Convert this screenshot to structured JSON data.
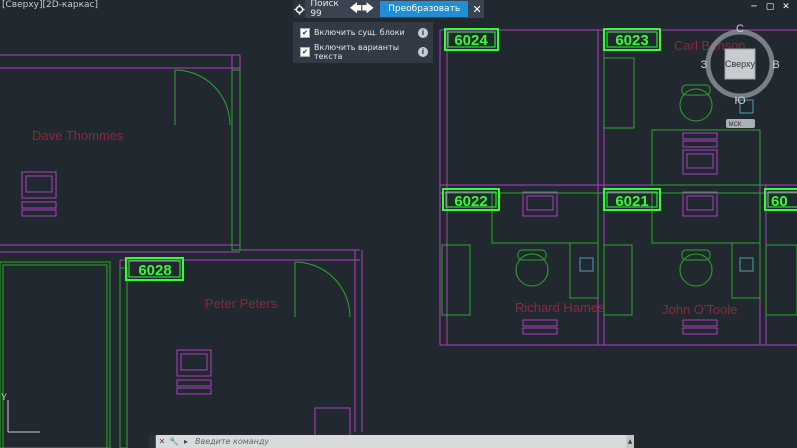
{
  "viewport": {
    "label": "[Сверху][2D-каркас]"
  },
  "find_toolbar": {
    "search_label": "Поиск 99",
    "prev_arrow": "🡄",
    "next_arrow": "🡆",
    "convert_label": "Преобразовать",
    "close_glyph": "✕"
  },
  "find_options": [
    {
      "label": "Включить сущ. блоки",
      "checked": true
    },
    {
      "label": "Включить варианты текста",
      "checked": true
    }
  ],
  "room_tags": [
    "6024",
    "6023",
    "6022",
    "6021",
    "60",
    "6028"
  ],
  "occupants": [
    "Dave Thommes",
    "Peter Peters",
    "Richard Hames",
    "John O'Toole",
    "Carl Benson"
  ],
  "viewcube": {
    "north": "С",
    "south": "Ю",
    "west": "З",
    "east": "В",
    "face": "Сверху",
    "ucs": "МСК"
  },
  "axis": {
    "y": "Y"
  },
  "command_line": {
    "placeholder": "Введите команду",
    "close": "✕",
    "wrench": "🔧",
    "chevron": "▸"
  },
  "window_buttons": {
    "min": "─",
    "restore": "▢",
    "close": "✕"
  },
  "colors": {
    "background": "#212830",
    "walls": "#b03fc0",
    "furniture": "#2ca82c",
    "tag": "#34ff34",
    "names": "#8a2a3a",
    "accent": "#1f8fd6"
  }
}
